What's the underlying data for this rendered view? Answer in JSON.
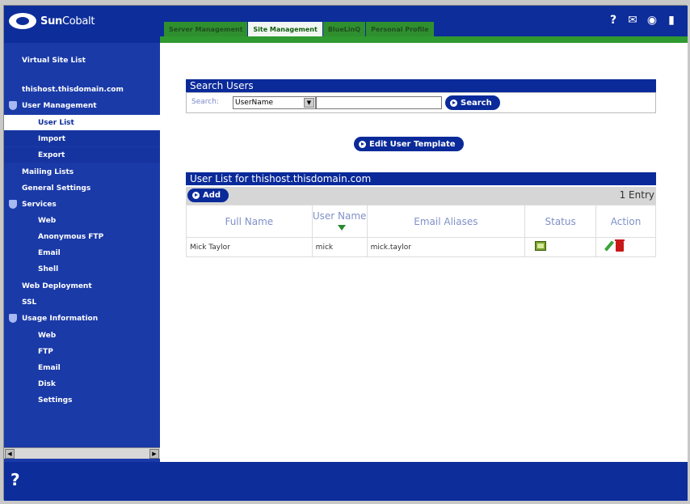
{
  "brand": {
    "sun": "Sun",
    "cobalt": "Cobalt"
  },
  "tabs": [
    {
      "label": "Server Management",
      "active": false
    },
    {
      "label": "Site Management",
      "active": true
    },
    {
      "label": "BlueLinQ",
      "active": false
    },
    {
      "label": "Personal Profile",
      "active": false
    }
  ],
  "top_icons": [
    "help-icon",
    "mail-icon",
    "info-icon",
    "logout-icon"
  ],
  "sidebar": {
    "items": [
      {
        "label": "Virtual Site List",
        "level": 0,
        "shield": false,
        "selected": false
      },
      {
        "label": "thishost.thisdomain.com",
        "level": 0,
        "shield": false,
        "selected": false
      },
      {
        "label": "User Management",
        "level": 0,
        "shield": true,
        "selected": false
      },
      {
        "label": "User List",
        "level": 1,
        "shield": false,
        "selected": true
      },
      {
        "label": "Import",
        "level": 1,
        "shield": false,
        "selected": false
      },
      {
        "label": "Export",
        "level": 1,
        "shield": false,
        "selected": false
      },
      {
        "label": "Mailing Lists",
        "level": 0,
        "shield": false,
        "selected": false
      },
      {
        "label": "General Settings",
        "level": 0,
        "shield": false,
        "selected": false
      },
      {
        "label": "Services",
        "level": 0,
        "shield": true,
        "selected": false
      },
      {
        "label": "Web",
        "level": 1,
        "shield": false,
        "selected": false
      },
      {
        "label": "Anonymous FTP",
        "level": 1,
        "shield": false,
        "selected": false
      },
      {
        "label": "Email",
        "level": 1,
        "shield": false,
        "selected": false
      },
      {
        "label": "Shell",
        "level": 1,
        "shield": false,
        "selected": false
      },
      {
        "label": "Web Deployment",
        "level": 0,
        "shield": false,
        "selected": false
      },
      {
        "label": "SSL",
        "level": 0,
        "shield": false,
        "selected": false
      },
      {
        "label": "Usage Information",
        "level": 0,
        "shield": true,
        "selected": false
      },
      {
        "label": "Web",
        "level": 1,
        "shield": false,
        "selected": false
      },
      {
        "label": "FTP",
        "level": 1,
        "shield": false,
        "selected": false
      },
      {
        "label": "Email",
        "level": 1,
        "shield": false,
        "selected": false
      },
      {
        "label": "Disk",
        "level": 1,
        "shield": false,
        "selected": false
      },
      {
        "label": "Settings",
        "level": 1,
        "shield": false,
        "selected": false
      }
    ]
  },
  "search": {
    "title": "Search Users",
    "label": "Search:",
    "field_selected": "UserName",
    "value": "",
    "button": "Search"
  },
  "edit_template_button": "Edit User Template",
  "user_list": {
    "title": "User List for thishost.thisdomain.com",
    "add_button": "Add",
    "entry_count": "1 Entry",
    "columns": [
      "Full Name",
      "User Name",
      "Email Aliases",
      "Status",
      "Action"
    ],
    "rows": [
      {
        "full_name": "Mick Taylor",
        "user_name": "mick",
        "email_aliases": "mick.taylor"
      }
    ]
  },
  "help_glyph": "?"
}
